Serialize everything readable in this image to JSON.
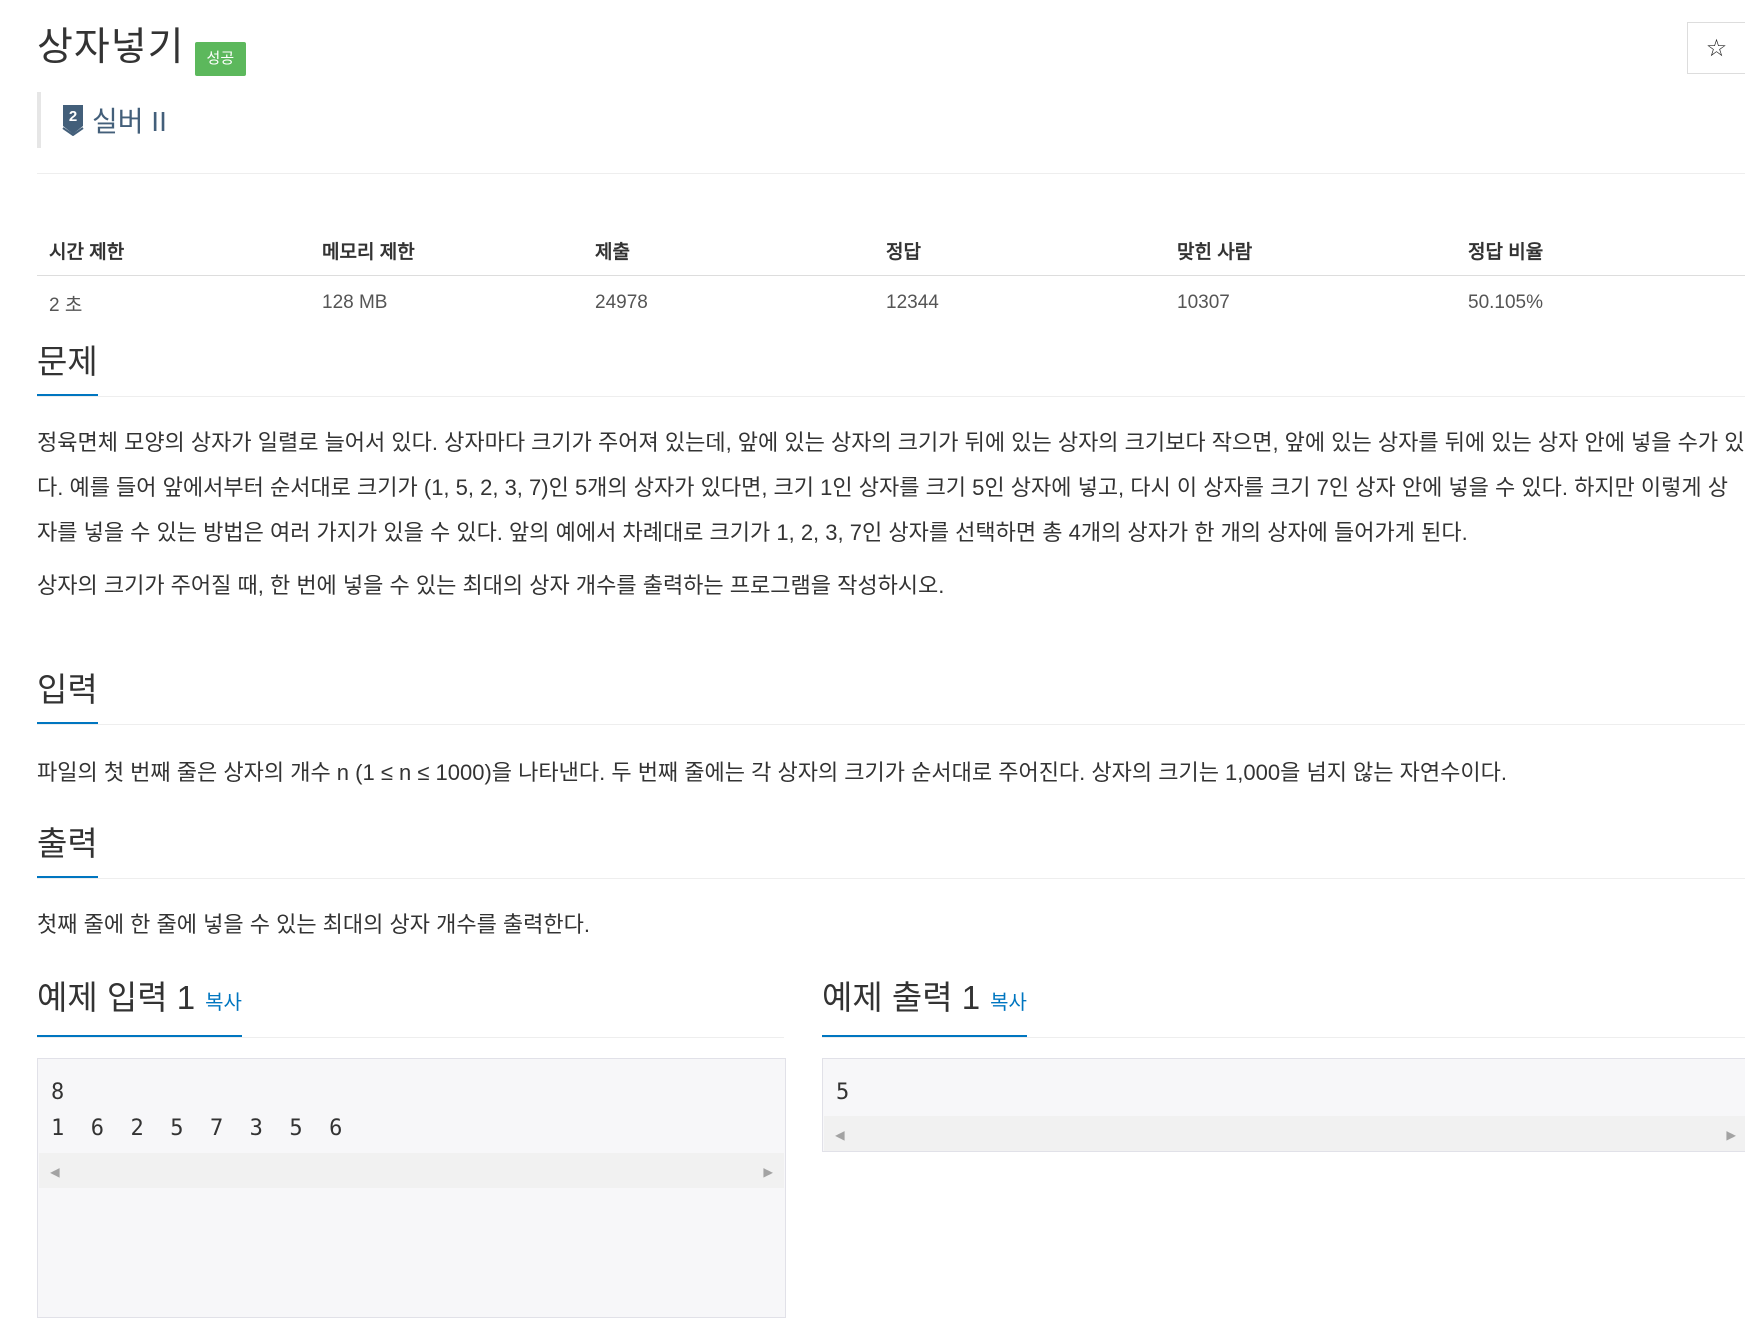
{
  "header": {
    "title": "상자넣기",
    "status_badge": "성공",
    "star_icon": "☆",
    "tier": {
      "level": "2",
      "label": "실버 II",
      "icon": "silver-tier-icon"
    }
  },
  "stats": {
    "headers": [
      "시간 제한",
      "메모리 제한",
      "제출",
      "정답",
      "맞힌 사람",
      "정답 비율"
    ],
    "values": [
      "2 초",
      "128 MB",
      "24978",
      "12344",
      "10307",
      "50.105%"
    ]
  },
  "problem": {
    "heading": "문제",
    "paragraphs": [
      "정육면체 모양의 상자가 일렬로 늘어서 있다. 상자마다 크기가 주어져 있는데, 앞에 있는 상자의 크기가 뒤에 있는 상자의 크기보다 작으면, 앞에 있는 상자를 뒤에 있는 상자 안에 넣을 수가 있다. 예를 들어 앞에서부터 순서대로 크기가 (1, 5, 2, 3, 7)인 5개의 상자가 있다면, 크기 1인 상자를 크기 5인 상자에 넣고, 다시 이 상자를 크기 7인 상자 안에 넣을 수 있다. 하지만 이렇게 상자를 넣을 수 있는 방법은 여러 가지가 있을 수 있다. 앞의 예에서 차례대로 크기가 1, 2, 3, 7인 상자를 선택하면 총 4개의 상자가 한 개의 상자에 들어가게 된다.",
      "상자의 크기가 주어질 때, 한 번에 넣을 수 있는 최대의 상자 개수를 출력하는 프로그램을 작성하시오."
    ]
  },
  "input": {
    "heading": "입력",
    "text": "파일의 첫 번째 줄은 상자의 개수 n (1 ≤ n ≤ 1000)을 나타낸다. 두 번째 줄에는 각 상자의 크기가 순서대로 주어진다. 상자의 크기는 1,000을 넘지 않는 자연수이다."
  },
  "output": {
    "heading": "출력",
    "text": "첫째 줄에 한 줄에 넣을 수 있는 최대의 상자 개수를 출력한다."
  },
  "sample_input": {
    "heading": "예제 입력 1",
    "copy_label": "복사",
    "content": "8\n1  6  2  5  7  3  5  6"
  },
  "sample_output": {
    "heading": "예제 출력 1",
    "copy_label": "복사",
    "content": "5"
  },
  "colors": {
    "accent": "#0076c0",
    "success": "#5cb85c",
    "tier_silver": "#435f7a"
  }
}
